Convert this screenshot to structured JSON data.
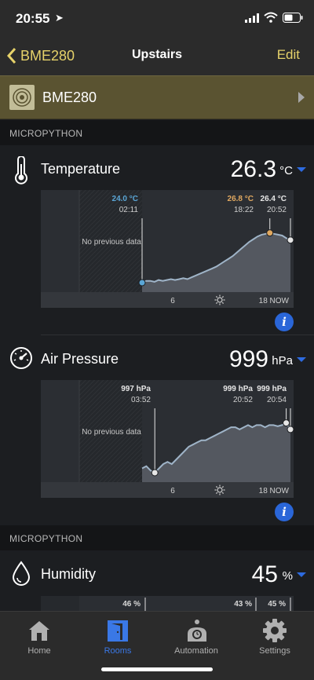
{
  "status": {
    "time": "20:55"
  },
  "nav": {
    "back_label": "BME280",
    "title": "Upstairs",
    "edit_label": "Edit"
  },
  "device": {
    "name": "BME280"
  },
  "sections": [
    {
      "label": "MICROPYTHON"
    },
    {
      "label": "MICROPYTHON"
    }
  ],
  "colors": {
    "accent": "#e6d26a",
    "blue": "#2d6be0",
    "device_bg": "#5a5331"
  },
  "sensors": [
    {
      "label": "Temperature",
      "value": "26.3",
      "unit": "°C",
      "icon": "thermometer-icon",
      "no_data": "No previous data",
      "markers": [
        {
          "value": "24.0 °C",
          "time": "02:11"
        },
        {
          "value": "26.8 °C",
          "time": "18:22"
        },
        {
          "value": "26.4 °C",
          "time": "20:52"
        }
      ],
      "axis": {
        "left": "6",
        "right": "18 NOW"
      },
      "series": [
        24.0,
        24.1,
        24.1,
        24.05,
        24.15,
        24.1,
        24.15,
        24.2,
        24.15,
        24.2,
        24.25,
        24.2,
        24.3,
        24.4,
        24.5,
        24.6,
        24.7,
        24.8,
        24.9,
        25.05,
        25.2,
        25.35,
        25.5,
        25.7,
        25.9,
        26.1,
        26.3,
        26.45,
        26.6,
        26.7,
        26.75,
        26.8,
        26.75,
        26.7,
        26.65,
        26.5,
        26.4
      ]
    },
    {
      "label": "Air Pressure",
      "value": "999",
      "unit": "hPa",
      "icon": "gauge-icon",
      "no_data": "No previous data",
      "markers": [
        {
          "value": "997 hPa",
          "time": "03:52"
        },
        {
          "value": "999 hPa",
          "time": "20:52"
        },
        {
          "value": "999 hPa",
          "time": "20:54"
        }
      ],
      "axis": {
        "left": "6",
        "right": "18 NOW"
      },
      "series": [
        997.2,
        997.3,
        997.1,
        997.0,
        997.2,
        997.4,
        997.5,
        997.4,
        997.6,
        997.8,
        998.0,
        998.2,
        998.3,
        998.4,
        998.5,
        998.5,
        998.6,
        998.7,
        998.8,
        998.9,
        999.0,
        999.1,
        999.1,
        999.0,
        999.1,
        999.2,
        999.1,
        999.2,
        999.2,
        999.1,
        999.2,
        999.2,
        999.15,
        999.2,
        999.3,
        999.0
      ]
    },
    {
      "label": "Humidity",
      "value": "45",
      "unit": "%",
      "icon": "droplet-icon",
      "markers": [
        {
          "value": "46 %"
        },
        {
          "value": "43 %"
        },
        {
          "value": "45 %"
        }
      ]
    }
  ],
  "tabs": [
    {
      "label": "Home",
      "icon": "house-icon"
    },
    {
      "label": "Rooms",
      "icon": "door-icon",
      "active": true
    },
    {
      "label": "Automation",
      "icon": "robot-icon"
    },
    {
      "label": "Settings",
      "icon": "gear-icon"
    }
  ]
}
